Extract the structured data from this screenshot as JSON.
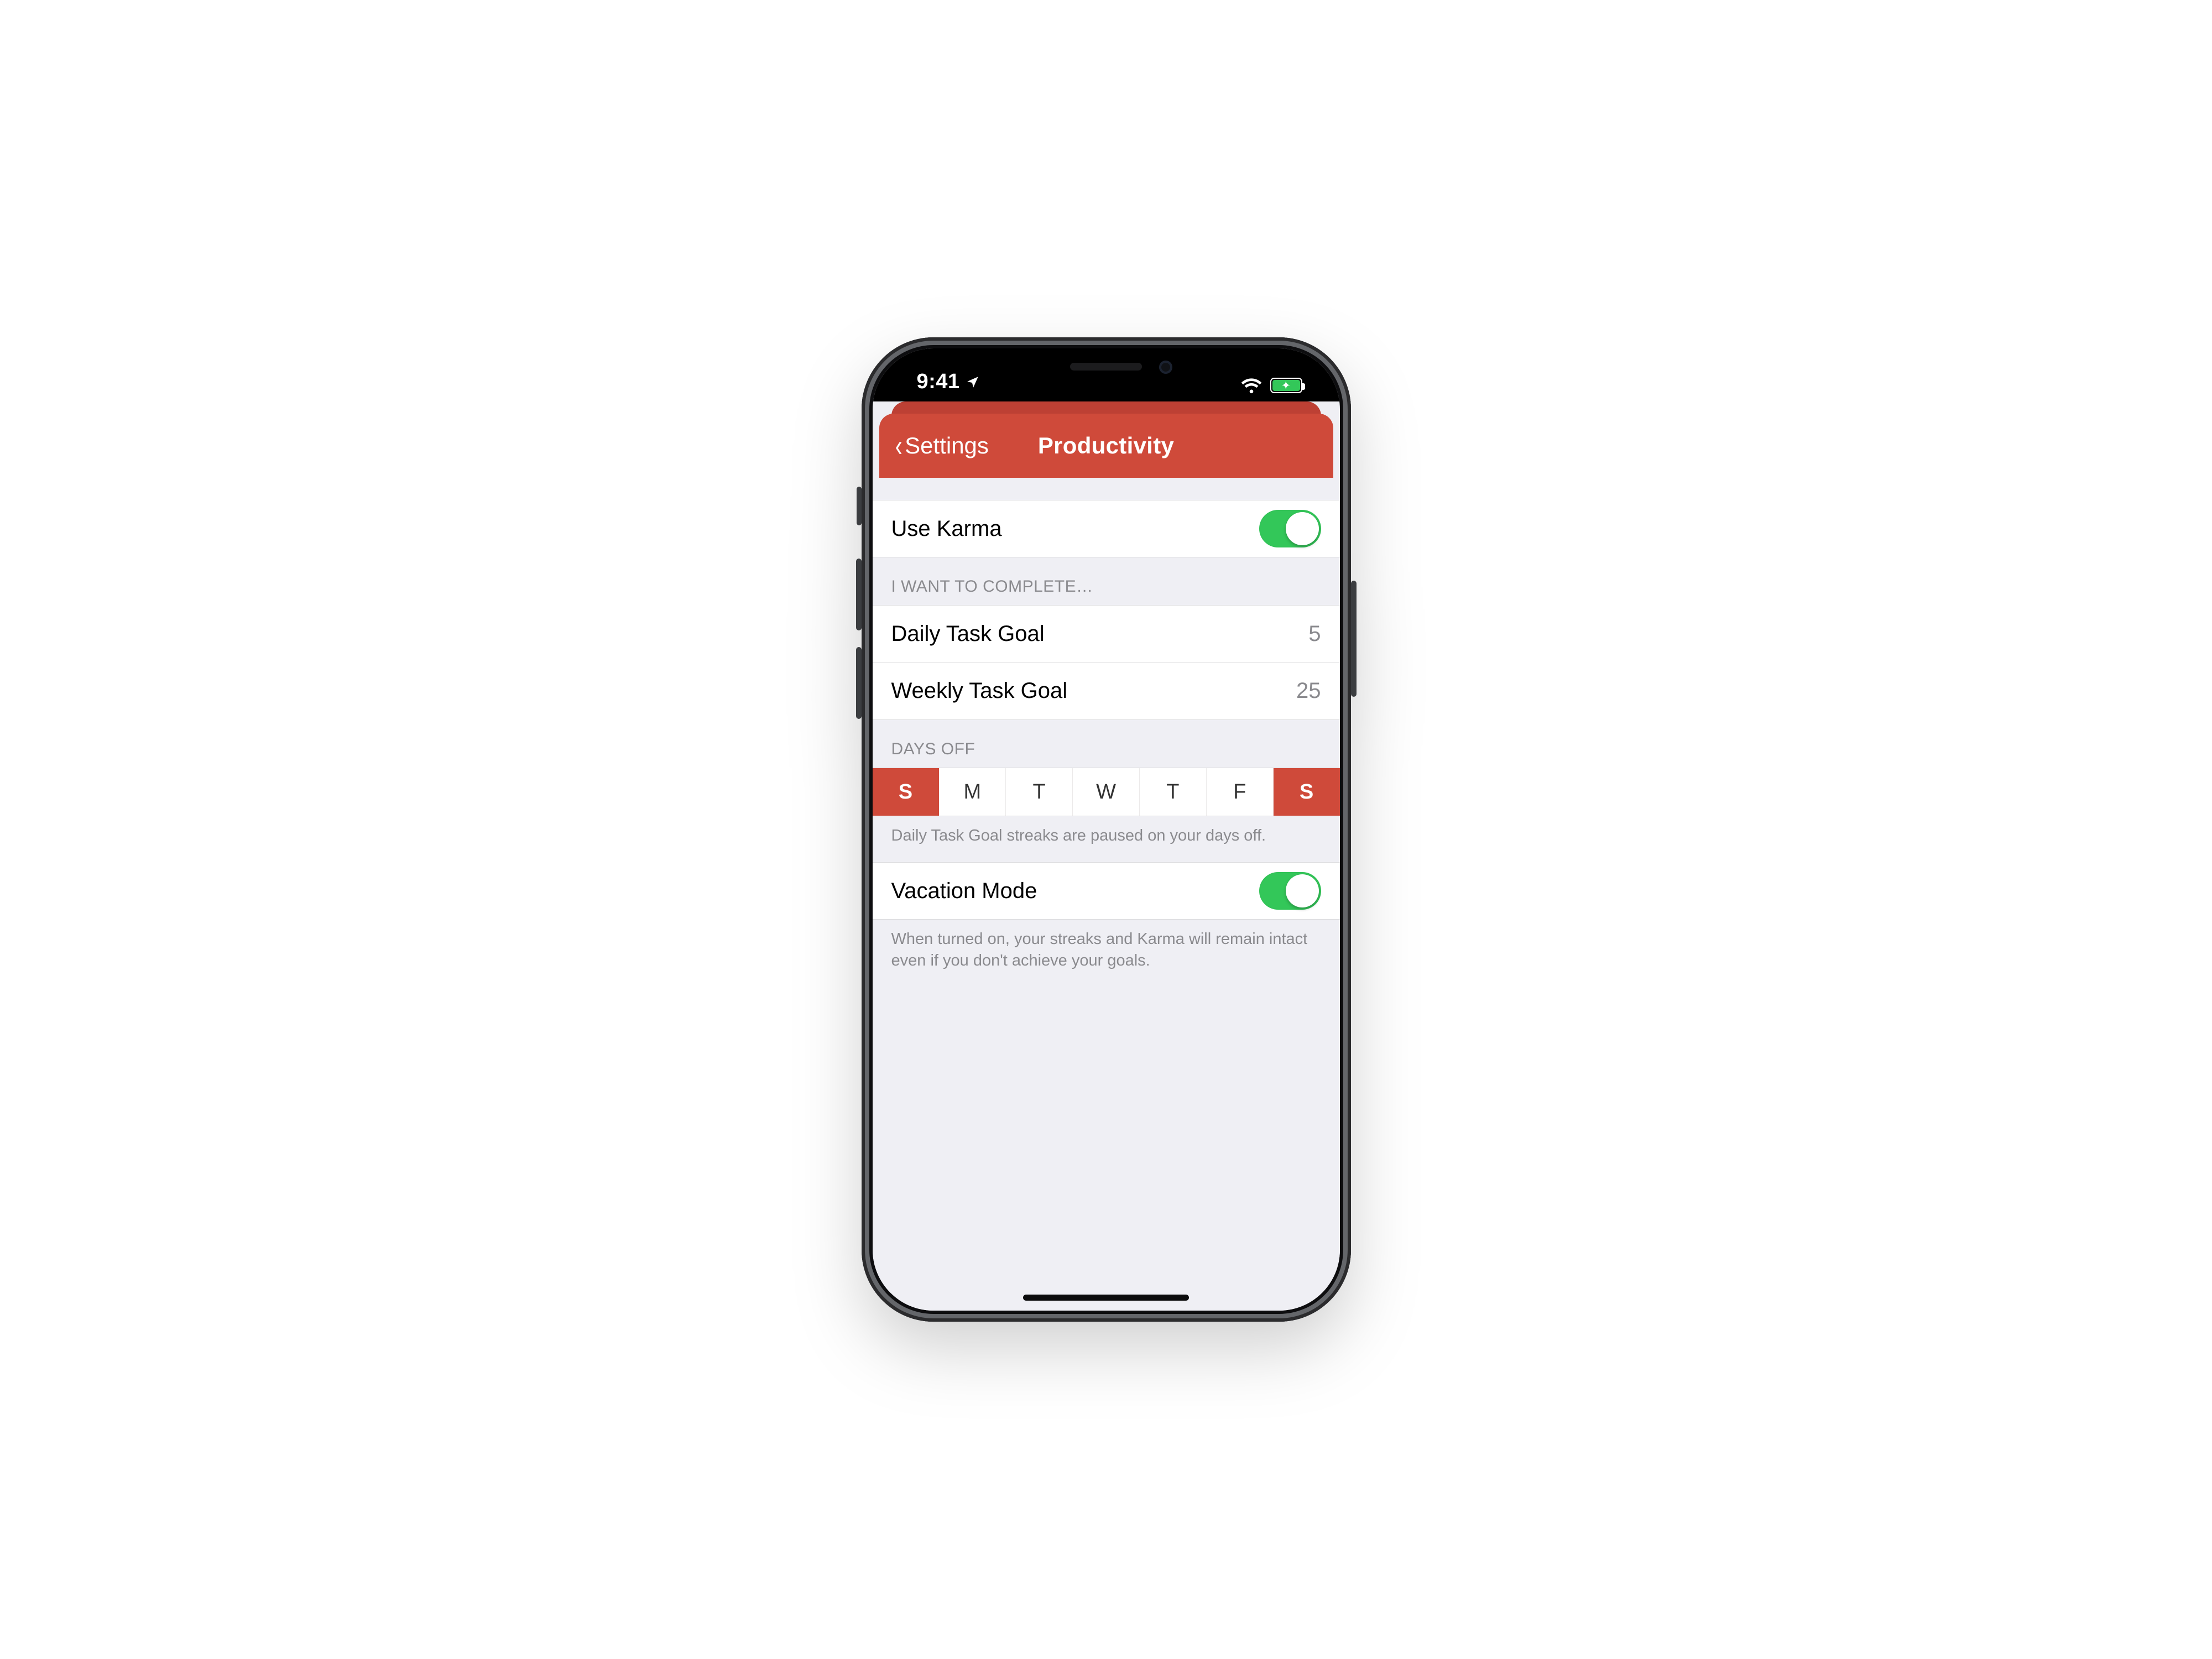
{
  "status": {
    "time": "9:41",
    "location_icon": "location-arrow",
    "wifi_icon": "wifi",
    "battery_state": "charging-full"
  },
  "nav": {
    "back_label": "Settings",
    "title": "Productivity"
  },
  "karma": {
    "label": "Use Karma",
    "on": true
  },
  "goals": {
    "section_header": "I WANT TO COMPLETE…",
    "daily": {
      "label": "Daily Task Goal",
      "value": "5"
    },
    "weekly": {
      "label": "Weekly Task Goal",
      "value": "25"
    }
  },
  "days_off": {
    "section_header": "DAYS OFF",
    "days": [
      {
        "letter": "S",
        "selected": true
      },
      {
        "letter": "M",
        "selected": false
      },
      {
        "letter": "T",
        "selected": false
      },
      {
        "letter": "W",
        "selected": false
      },
      {
        "letter": "T",
        "selected": false
      },
      {
        "letter": "F",
        "selected": false
      },
      {
        "letter": "S",
        "selected": true
      }
    ],
    "footer": "Daily Task Goal streaks are paused on your days off."
  },
  "vacation": {
    "label": "Vacation Mode",
    "on": true,
    "footer": "When turned on, your streaks and Karma will remain intact even if you don't achieve your goals."
  },
  "colors": {
    "accent": "#cf4a3a",
    "switch_on": "#33c759",
    "bg": "#efeff4"
  }
}
